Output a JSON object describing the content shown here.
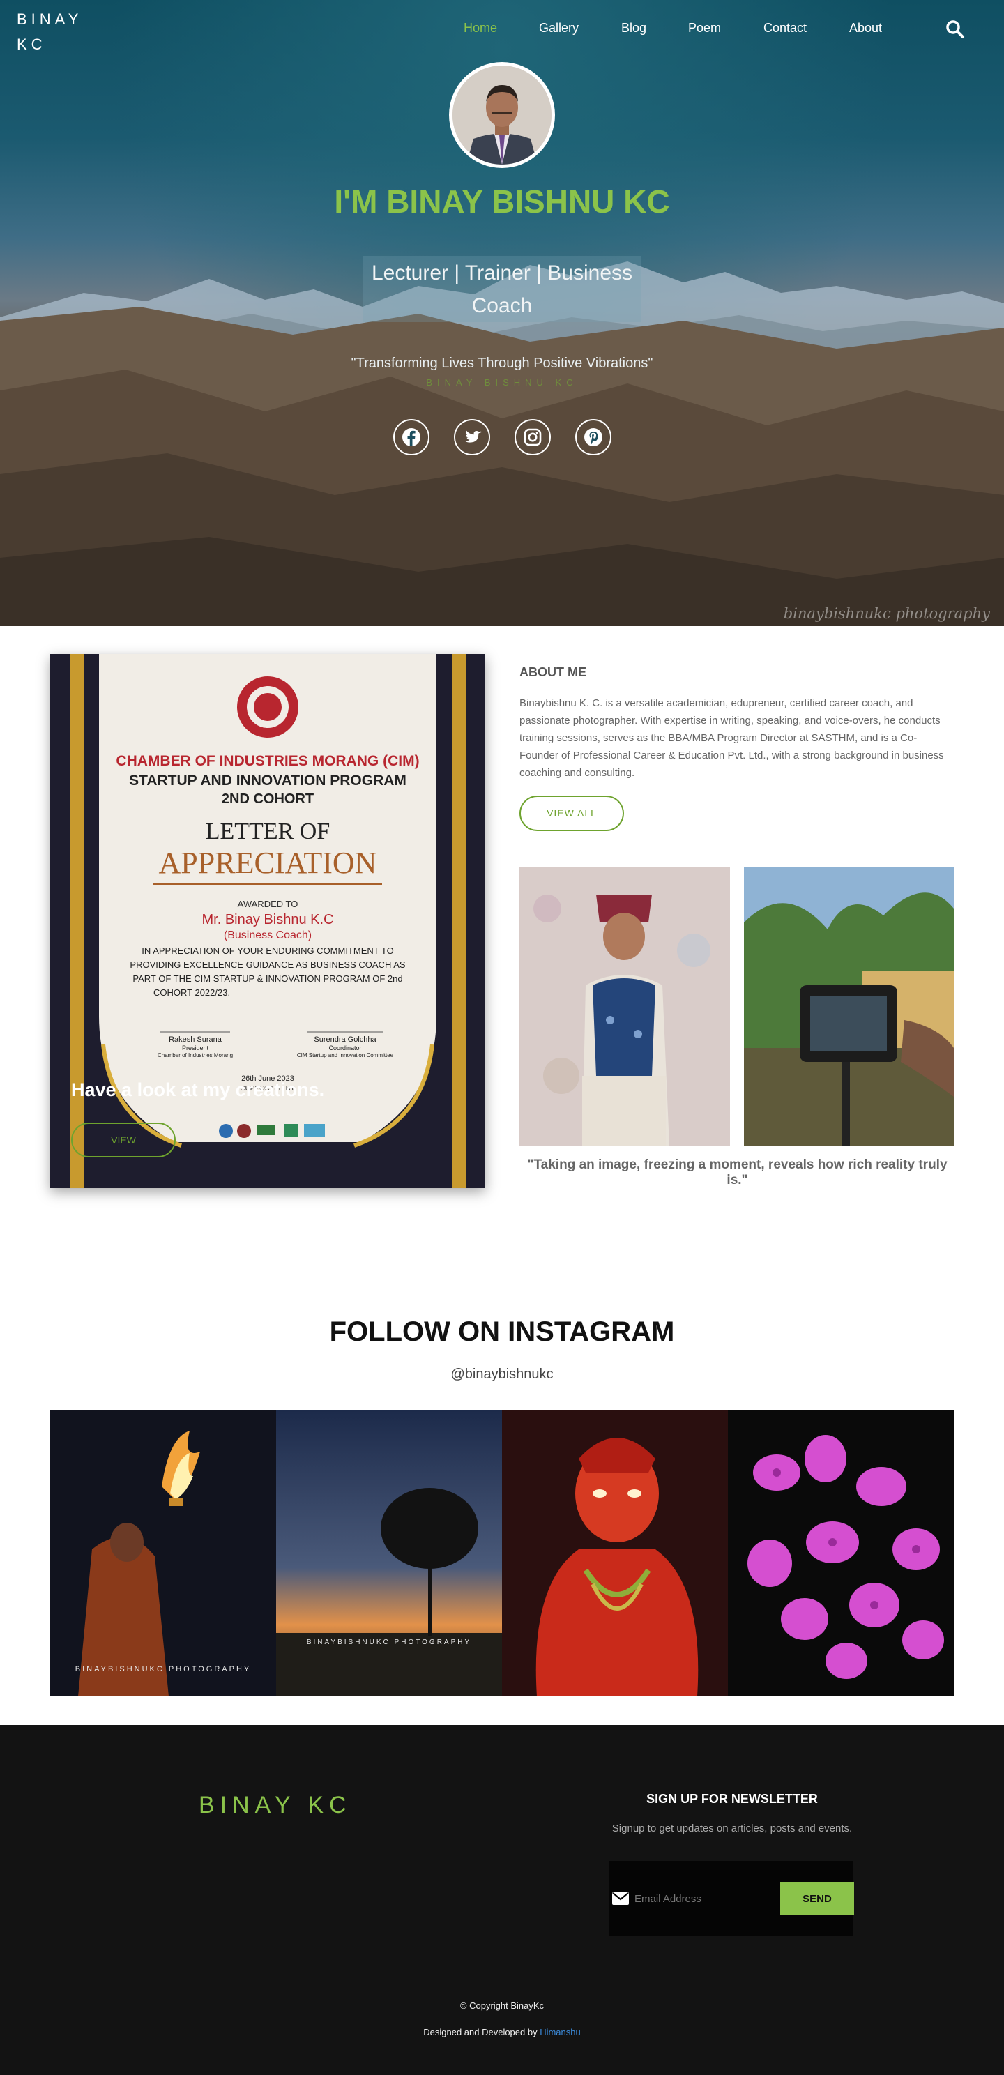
{
  "brand": {
    "logo": "BINAY\nKC",
    "footer_logo": "BINAY KC"
  },
  "nav": {
    "items": [
      {
        "label": "Home",
        "active": true
      },
      {
        "label": "Gallery",
        "active": false
      },
      {
        "label": "Blog",
        "active": false
      },
      {
        "label": "Poem",
        "active": false
      },
      {
        "label": "Contact",
        "active": false
      },
      {
        "label": "About",
        "active": false
      }
    ],
    "search_icon": "search-icon"
  },
  "hero": {
    "title": "I'M BINAY BISHNU KC",
    "roles": "Lecturer | Trainer | Business Coach",
    "quote": "\"Transforming Lives Through Positive Vibrations\"",
    "signature": "BINAY BISHNU KC",
    "watermark": "binaybishnukc photography",
    "socials": [
      "facebook-icon",
      "twitter-icon",
      "instagram-icon",
      "pinterest-icon"
    ]
  },
  "about": {
    "certificate_caption": "Have a look at my creations.",
    "certificate_button": "VIEW",
    "heading": "ABOUT ME",
    "text": "Binaybishnu K. C. is a versatile academician, edupreneur, certified career coach, and passionate photographer. With expertise in writing, speaking, and voice-overs, he conducts training sessions, serves as the BBA/MBA Program Director at SASTHM, and is a Co-Founder of Professional Career & Education Pvt. Ltd., with a strong background in business coaching and consulting.",
    "button": "VIEW ALL",
    "quote": "\"Taking an image, freezing a moment, reveals how rich reality truly is.\""
  },
  "certificate": {
    "org": "CHAMBER OF INDUSTRIES MORANG (CIM)",
    "program": "STARTUP AND INNOVATION PROGRAM",
    "cohort": "2ND COHORT",
    "letter_of": "LETTER OF",
    "appreciation": "APPRECIATION",
    "awarded_to": "AWARDED TO",
    "name": "Mr. Binay Bishnu K.C",
    "role": "(Business Coach)",
    "body": "IN APPRECIATION OF YOUR ENDURING COMMITMENT TO PROVIDING EXCELLENCE GUIDANCE AS BUSINESS COACH AS PART OF THE CIM STARTUP & INNOVATION PROGRAM OF 2nd COHORT 2022/23.",
    "signer1": "Rakesh Surana",
    "signer1_role": "President",
    "signer1_org": "Chamber of Industries Morang",
    "signer2": "Surendra Golchha",
    "signer2_role": "Coordinator",
    "signer2_org": "CIM Startup and Innovation Committee",
    "date": "26th June 2023",
    "supported_by": "SUPPORTED BY"
  },
  "instagram": {
    "title": "FOLLOW ON INSTAGRAM",
    "handle": "@binaybishnukc",
    "tiles": [
      {
        "label": "BINAYBISHNUKC PHOTOGRAPHY"
      },
      {
        "label": "BINAYBISHNUKC PHOTOGRAPHY"
      },
      {
        "label": ""
      },
      {
        "label": ""
      }
    ]
  },
  "newsletter": {
    "title": "SIGN UP FOR NEWSLETTER",
    "subtitle": "Signup to get updates on articles, posts and events.",
    "email_placeholder": "Email Address",
    "send_label": "SEND"
  },
  "footer": {
    "copyright": "© Copyright BinayKc",
    "credits_prefix": "Designed and Developed by ",
    "credits_link": "Himanshu"
  },
  "colors": {
    "accent": "#8bc34a",
    "link": "#3b8ad9",
    "footer_bg": "#131313"
  }
}
